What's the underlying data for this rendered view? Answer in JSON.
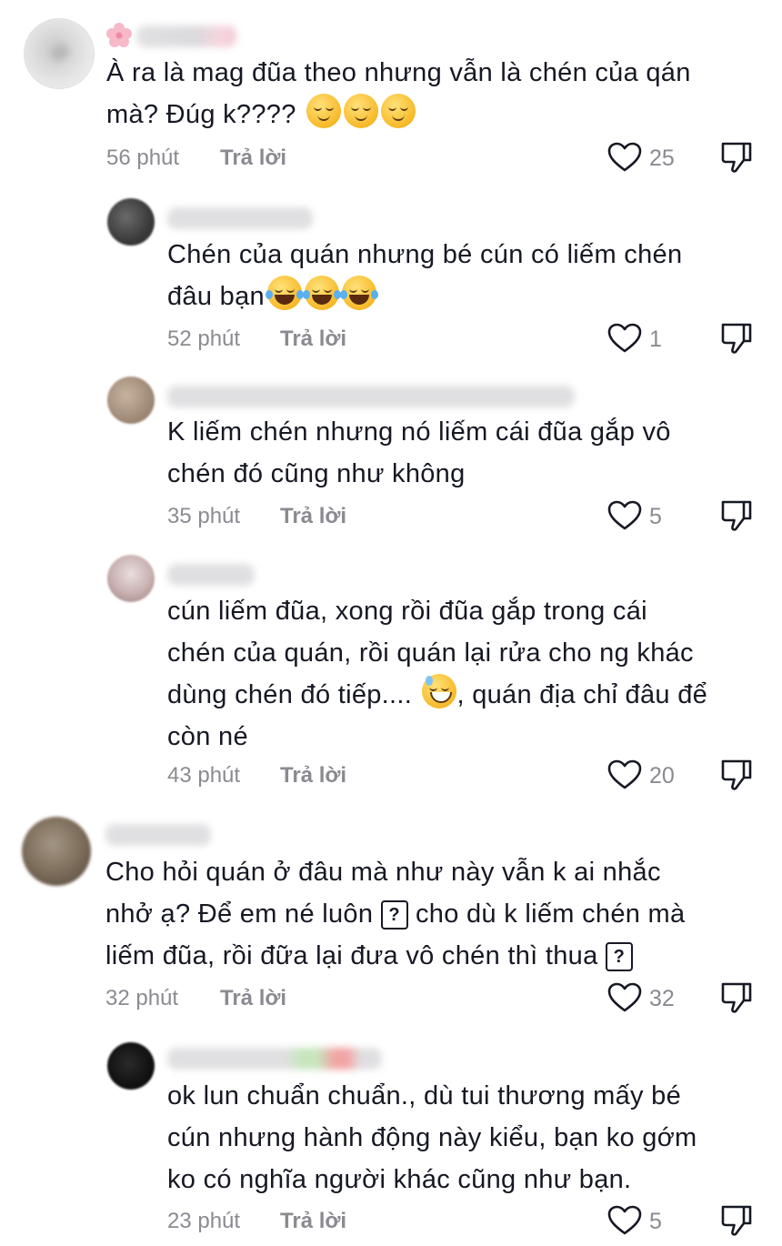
{
  "comments": [
    {
      "level": "top",
      "text_lines": [
        "À ra là mag đũa theo nhưng vẫn là chén của qán",
        "mà? Đúg k????"
      ],
      "time": "56 phút",
      "reply": "Trả lời",
      "likes": "25"
    },
    {
      "level": "reply",
      "text_lines": [
        "Chén của quán nhưng bé cún có liếm chén",
        "đâu bạn"
      ],
      "time": "52 phút",
      "reply": "Trả lời",
      "likes": "1"
    },
    {
      "level": "reply",
      "text_lines": [
        "K liếm chén nhưng nó liếm cái đũa gắp vô",
        "chén đó cũng như không"
      ],
      "time": "35 phút",
      "reply": "Trả lời",
      "likes": "5"
    },
    {
      "level": "reply",
      "text_lines": [
        "cún liếm đũa, xong rồi đũa gắp trong cái",
        "chén của quán, rồi quán lại rửa cho ng khác",
        "dùng chén đó tiếp.... ",
        ", quán địa chỉ đâu để",
        "còn né"
      ],
      "time": "43 phút",
      "reply": "Trả lời",
      "likes": "20"
    },
    {
      "level": "top",
      "text_lines": [
        "Cho hỏi quán ở đâu mà như này vẫn k ai nhắc",
        "nhở ạ? Để em né luôn ",
        " cho dù k liếm chén mà",
        "liếm đũa, rồi đữa lại đưa vô chén thì thua "
      ],
      "time": "32 phút",
      "reply": "Trả lời",
      "likes": "32"
    },
    {
      "level": "reply",
      "text_lines": [
        "ok lun chuẩn chuẩn., dù tui thương mấy bé",
        "cún nhưng hành động này kiểu, bạn ko gớm",
        "ko có nghĩa người khác cũng như bạn."
      ],
      "time": "23 phút",
      "reply": "Trả lời",
      "likes": "5"
    }
  ],
  "icons": {
    "like": "heart-outline-icon",
    "dislike": "thumbs-down-outline-icon",
    "unknown_glyph": "?"
  },
  "colors": {
    "text": "#161823",
    "meta": "#8a8b91"
  }
}
